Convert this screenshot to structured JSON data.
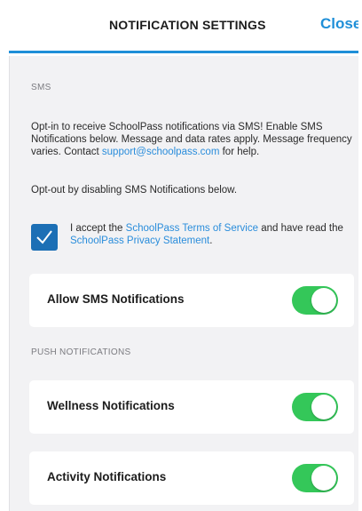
{
  "header": {
    "title": "NOTIFICATION SETTINGS",
    "close_label": "Close"
  },
  "sms": {
    "section_label": "SMS",
    "opt_in_text": "Opt-in to receive SchoolPass notifications via SMS! Enable SMS Notifications below. Message and data rates apply. Message frequency varies. Contact ",
    "support_email": "support@schoolpass.com",
    "opt_in_suffix": " for help.",
    "opt_out_text": "Opt-out by disabling SMS Notifications below.",
    "accept": {
      "checked": true,
      "prefix": "I accept the ",
      "terms_link": "SchoolPass Terms of Service",
      "middle": " and have read the ",
      "privacy_link": "SchoolPass Privacy Statement",
      "suffix": "."
    },
    "allow_sms": {
      "label": "Allow SMS Notifications",
      "enabled": true
    }
  },
  "push": {
    "section_label": "PUSH NOTIFICATIONS",
    "items": [
      {
        "label": "Wellness Notifications",
        "enabled": true
      },
      {
        "label": "Activity Notifications",
        "enabled": true
      }
    ]
  },
  "colors": {
    "accent": "#1f8fd8",
    "toggle_on": "#34c759",
    "checkbox": "#1c6fb5",
    "background": "#f2f2f4"
  }
}
